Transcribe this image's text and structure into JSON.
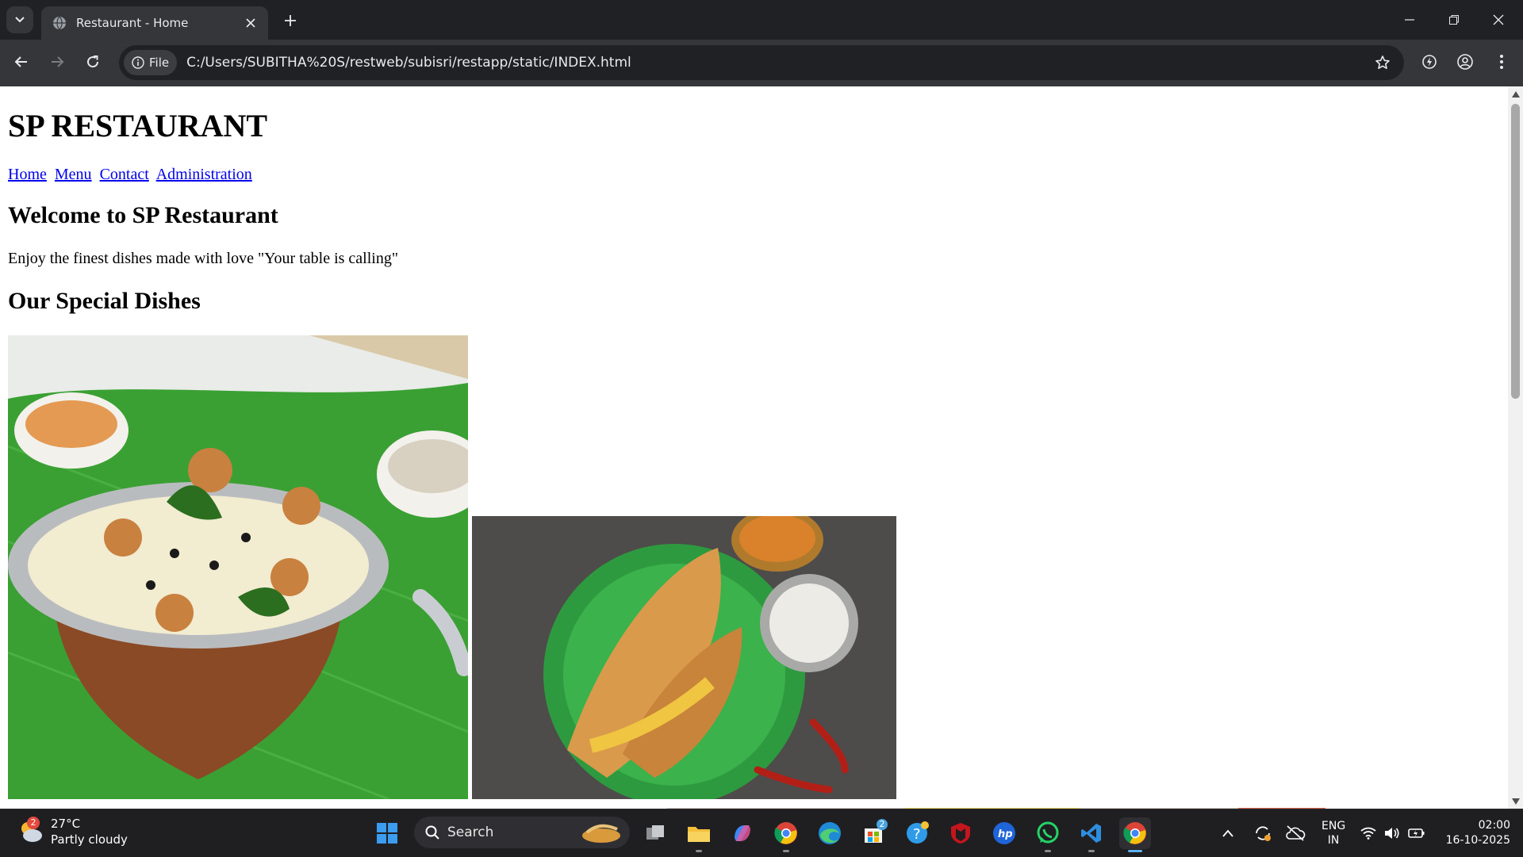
{
  "browser": {
    "tab_title": "Restaurant - Home",
    "url_chip": "File",
    "url": "C:/Users/SUBITHA%20S/restweb/subisri/restapp/static/INDEX.html"
  },
  "page": {
    "site_title": "SP RESTAURANT",
    "nav": [
      "Home",
      "Menu",
      "Contact",
      "Administration"
    ],
    "welcome_heading": "Welcome to SP Restaurant",
    "tagline": "Enjoy the finest dishes made with love \"Your table is calling\"",
    "special_heading": "Our Special Dishes",
    "dishes": [
      "pongal-bowl-photo",
      "masala-dosa-photo",
      "third-dish-photo"
    ]
  },
  "taskbar": {
    "weather_temp": "27°C",
    "weather_desc": "Partly cloudy",
    "weather_badge": "2",
    "search_label": "Search",
    "store_badge": "2",
    "lang_1": "ENG",
    "lang_2": "IN",
    "time": "02:00",
    "date": "16-10-2025"
  },
  "colors": {
    "link": "#0000ee",
    "chrome_dark": "#202124",
    "chrome_toolbar": "#35363a"
  }
}
